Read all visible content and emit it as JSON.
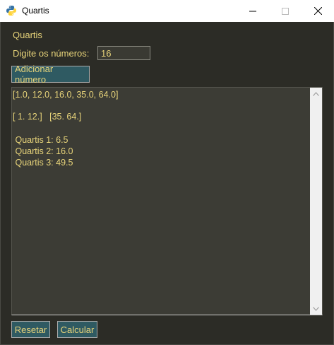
{
  "window": {
    "title": "Quartis",
    "icon": "python-icon",
    "controls": [
      "minimize-icon",
      "maximize-icon",
      "close-icon"
    ]
  },
  "form": {
    "heading": "Quartis",
    "prompt": "Digite os números:",
    "input_value": "16",
    "add_button": "Adicionar número"
  },
  "output": {
    "lines": [
      "[1.0, 12.0, 16.0, 35.0, 64.0]",
      "",
      "[ 1. 12.]   [35. 64.]",
      "",
      " Quartis 1: 6.5",
      " Quartis 2: 16.0",
      " Quartis 3: 49.5"
    ]
  },
  "footer": {
    "reset_button": "Resetar",
    "calc_button": "Calcular"
  },
  "colors": {
    "background": "#2c2c26",
    "text": "#e8d47a",
    "button": "#2f5a62",
    "output_bg": "#3c3c35"
  }
}
